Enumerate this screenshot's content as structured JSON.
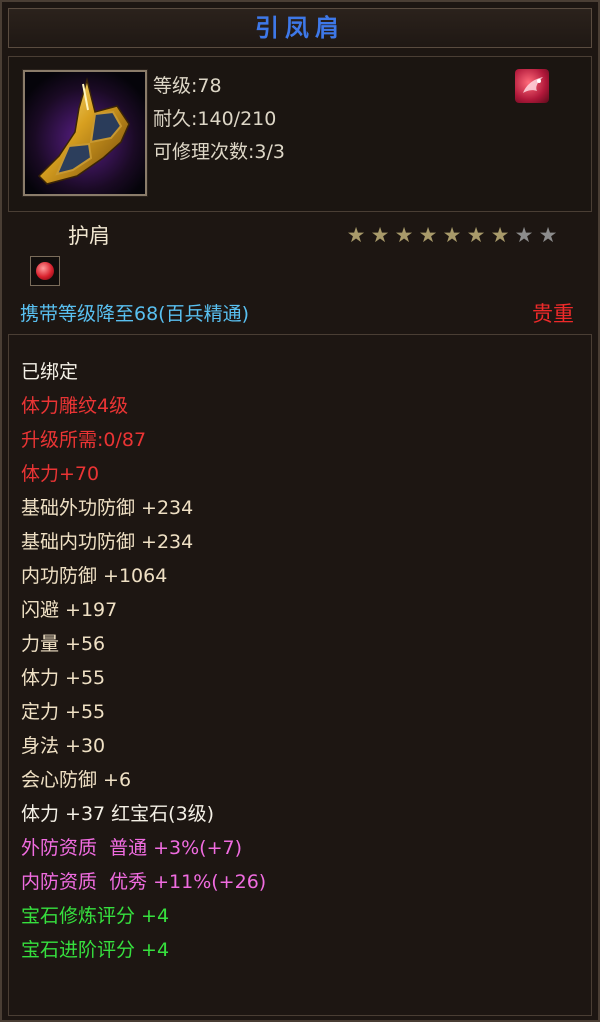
{
  "title": "引凤肩",
  "header": {
    "level": "等级:78",
    "durability": "耐久:140/210",
    "repair": "可修理次数:3/3",
    "item_icon": "shoulder-armor-icon",
    "quality_icon": "dragon-emblem-icon"
  },
  "type_label": "护肩",
  "stars": {
    "filled": 7,
    "total": 9
  },
  "gem_slot_icon": "ruby-gem-icon",
  "carry_level": "携带等级降至68(百兵精通)",
  "rarity": "贵重",
  "attributes": [
    {
      "text": "已绑定",
      "color": "white"
    },
    {
      "text": "体力雕纹4级",
      "color": "red"
    },
    {
      "text": "升级所需:0/87",
      "color": "red"
    },
    {
      "text": "体力+70",
      "color": "red"
    },
    {
      "text": "基础外功防御 +234",
      "color": "cream"
    },
    {
      "text": "基础内功防御 +234",
      "color": "cream"
    },
    {
      "text": "内功防御 +1064",
      "color": "cream"
    },
    {
      "text": "闪避 +197",
      "color": "cream"
    },
    {
      "text": "力量 +56",
      "color": "cream"
    },
    {
      "text": "体力 +55",
      "color": "cream"
    },
    {
      "text": "定力 +55",
      "color": "cream"
    },
    {
      "text": "身法 +30",
      "color": "cream"
    },
    {
      "text": "会心防御 +6",
      "color": "cream"
    },
    {
      "text": "体力 +37 红宝石(3级)",
      "color": "white"
    },
    {
      "text": "外防资质  普通 +3%(+7)",
      "color": "pink"
    },
    {
      "text": "内防资质  优秀 +11%(+26)",
      "color": "pink"
    },
    {
      "text": "宝石修炼评分 +4",
      "color": "green"
    },
    {
      "text": "宝石进阶评分 +4",
      "color": "green"
    }
  ],
  "colors": {
    "title": "#3e78e8",
    "star_filled": "#a89a6a",
    "star_empty": "#8c8c8c"
  }
}
